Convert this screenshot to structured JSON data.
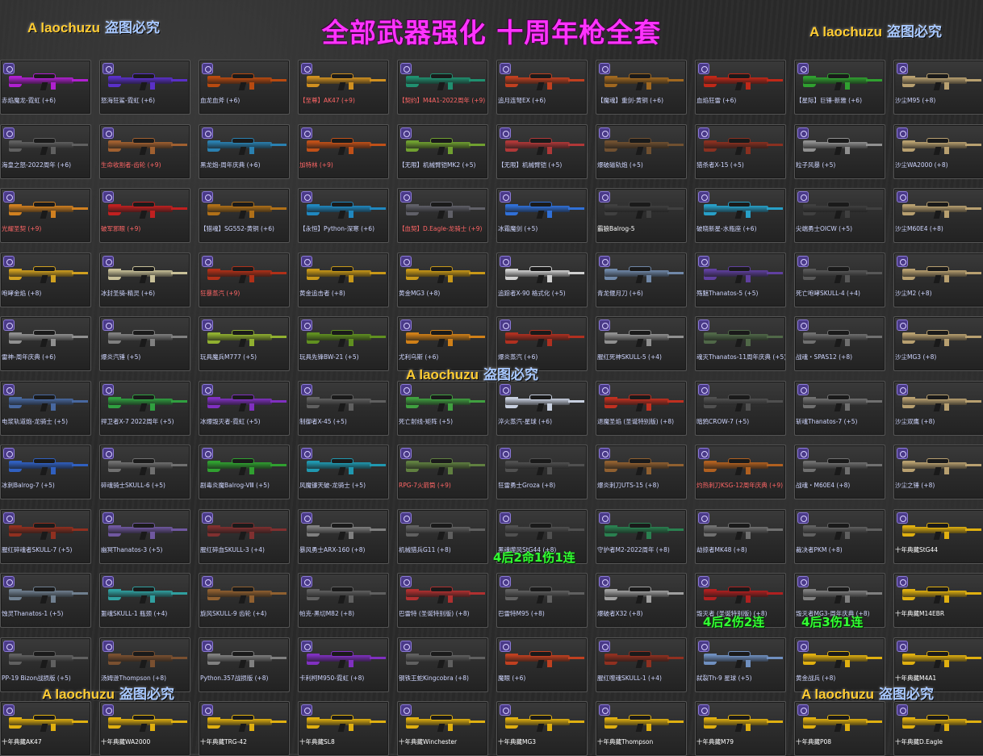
{
  "title": "全部武器强化  十周年枪全套",
  "watermark": {
    "en": "A laochuzu",
    "cn": "盗图必究"
  },
  "overlays": [
    "4后2命1伤1连",
    "4后2伤2连",
    "4后3伤1连"
  ],
  "items": [
    {
      "name": "赤焰魔龙-霓虹 (+6)",
      "color": "#b020d0",
      "label_color": "normal"
    },
    {
      "name": "怒海狂鲨-霓虹 (+6)",
      "color": "#5a30c8",
      "label_color": "normal"
    },
    {
      "name": "血龙血斧 (+6)",
      "color": "#b84a10",
      "label_color": "normal"
    },
    {
      "name": "【至尊】AK47 (+9)",
      "color": "#d09020",
      "label_color": "red"
    },
    {
      "name": "【契约】M4A1-2022周年 (+9)",
      "color": "#209070",
      "label_color": "red"
    },
    {
      "name": "追月连弩EX (+6)",
      "color": "#c04020",
      "label_color": "normal"
    },
    {
      "name": "【魔魂】重剑-黄铜 (+6)",
      "color": "#a06820",
      "label_color": "normal"
    },
    {
      "name": "血焰狂雷 (+6)",
      "color": "#c02818",
      "label_color": "normal"
    },
    {
      "name": "【星际】巨锤-新雅 (+6)",
      "color": "#30a030",
      "label_color": "normal"
    },
    {
      "name": "沙尘M95 (+8)",
      "color": "#b8a070",
      "label_color": "normal"
    },
    {
      "name": "海皇之怒-2022周年 (+6)",
      "color": "#606060",
      "label_color": "normal"
    },
    {
      "name": "生命收割者-齿轮 (+9)",
      "color": "#a06030",
      "label_color": "red"
    },
    {
      "name": "黑龙炮-周年庆典 (+6)",
      "color": "#2a80b0",
      "label_color": "normal"
    },
    {
      "name": "加特林 (+9)",
      "color": "#c05018",
      "label_color": "red"
    },
    {
      "name": "【无限】机械臂铠MK2 (+5)",
      "color": "#70a030",
      "label_color": "normal"
    },
    {
      "name": "【无限】机械臂铠 (+5)",
      "color": "#b03838",
      "label_color": "normal"
    },
    {
      "name": "爆破磁轨炮 (+5)",
      "color": "#705030",
      "label_color": "normal"
    },
    {
      "name": "猎杀者X-15 (+5)",
      "color": "#8a3020",
      "label_color": "normal"
    },
    {
      "name": "粒子风暴 (+5)",
      "color": "#909090",
      "label_color": "normal"
    },
    {
      "name": "沙尘WA2000 (+8)",
      "color": "#b8a070",
      "label_color": "normal"
    },
    {
      "name": "光耀圣契 (+9)",
      "color": "#d08020",
      "label_color": "red"
    },
    {
      "name": "破军邪眼 (+9)",
      "color": "#c02020",
      "label_color": "red"
    },
    {
      "name": "【猎魂】SG552-黄铜 (+6)",
      "color": "#b07018",
      "label_color": "normal"
    },
    {
      "name": "【永恒】Python-深寒 (+6)",
      "color": "#2088c0",
      "label_color": "normal"
    },
    {
      "name": "【血契】D.Eagle-龙骑士 (+9)",
      "color": "#606068",
      "label_color": "red"
    },
    {
      "name": "冰霜魔剑 (+5)",
      "color": "#3070d8",
      "label_color": "normal"
    },
    {
      "name": "霸狼Balrog-5",
      "color": "#404040",
      "label_color": "white"
    },
    {
      "name": "破晓新星-水瓶座 (+6)",
      "color": "#28a0c8",
      "label_color": "normal"
    },
    {
      "name": "尖端勇士OICW (+5)",
      "color": "#404040",
      "label_color": "normal"
    },
    {
      "name": "沙尘M60E4 (+8)",
      "color": "#b8a070",
      "label_color": "normal"
    },
    {
      "name": "咆哮金焰 (+8)",
      "color": "#d0a020",
      "label_color": "normal"
    },
    {
      "name": "冰封圣骑-精灵 (+6)",
      "color": "#c8c098",
      "label_color": "normal"
    },
    {
      "name": "狂暴蒸汽 (+9)",
      "color": "#b03018",
      "label_color": "red"
    },
    {
      "name": "黄金追击者 (+8)",
      "color": "#c89818",
      "label_color": "normal"
    },
    {
      "name": "黄金MG3 (+8)",
      "color": "#c89818",
      "label_color": "normal"
    },
    {
      "name": "追踪者X-90 格式化 (+5)",
      "color": "#d0d0d0",
      "label_color": "normal"
    },
    {
      "name": "青龙偃月刀 (+6)",
      "color": "#7088a8",
      "label_color": "normal"
    },
    {
      "name": "殇魅Thanatos-5 (+5)",
      "color": "#6040a0",
      "label_color": "normal"
    },
    {
      "name": "死亡咆哮SKULL-4 (+4)",
      "color": "#585858",
      "label_color": "normal"
    },
    {
      "name": "沙尘M2 (+8)",
      "color": "#b8a070",
      "label_color": "normal"
    },
    {
      "name": "雷神-周年庆典 (+6)",
      "color": "#909090",
      "label_color": "normal"
    },
    {
      "name": "爆炎汽锤 (+5)",
      "color": "#808080",
      "label_color": "normal"
    },
    {
      "name": "玩具魔兵M777 (+5)",
      "color": "#90b030",
      "label_color": "normal"
    },
    {
      "name": "玩具先锋BW-21 (+5)",
      "color": "#609020",
      "label_color": "normal"
    },
    {
      "name": "尤利乌斯 (+6)",
      "color": "#d08018",
      "label_color": "normal"
    },
    {
      "name": "爆炎蒸汽 (+6)",
      "color": "#b03020",
      "label_color": "normal"
    },
    {
      "name": "腥红死神SKULL-5 (+4)",
      "color": "#909090",
      "label_color": "normal"
    },
    {
      "name": "魂灭Thanatos-11周年庆典 (+5)",
      "color": "#506848",
      "label_color": "normal"
    },
    {
      "name": "战魂・SPAS12 (+8)",
      "color": "#707070",
      "label_color": "normal"
    },
    {
      "name": "沙尘MG3 (+8)",
      "color": "#b8a070",
      "label_color": "normal"
    },
    {
      "name": "电浆轨道炮-龙骑士 (+5)",
      "color": "#4868a0",
      "label_color": "normal"
    },
    {
      "name": "捍卫者X-7 2022周年 (+5)",
      "color": "#30a040",
      "label_color": "normal"
    },
    {
      "name": "冰爆毁灭者-霓虹 (+5)",
      "color": "#8030c0",
      "label_color": "normal"
    },
    {
      "name": "制御者X-45 (+5)",
      "color": "#606060",
      "label_color": "normal"
    },
    {
      "name": "死亡射线-矩阵 (+5)",
      "color": "#40a040",
      "label_color": "normal"
    },
    {
      "name": "淬火蒸汽-星球 (+6)",
      "color": "#c8d0e0",
      "label_color": "normal"
    },
    {
      "name": "退魔圣焰 (圣诞特别版) (+8)",
      "color": "#c03020",
      "label_color": "normal"
    },
    {
      "name": "暗鸦CROW-7 (+5)",
      "color": "#505050",
      "label_color": "normal"
    },
    {
      "name": "斩魂Thanatos-7 (+5)",
      "color": "#707070",
      "label_color": "normal"
    },
    {
      "name": "沙尘双鹰 (+8)",
      "color": "#b8a070",
      "label_color": "normal"
    },
    {
      "name": "冰刺Balrog-7 (+5)",
      "color": "#3060c0",
      "label_color": "normal"
    },
    {
      "name": "碎魂骑士SKULL-6 (+5)",
      "color": "#707070",
      "label_color": "normal"
    },
    {
      "name": "剧毒炎魔Balrog-VⅢ (+5)",
      "color": "#30a030",
      "label_color": "normal"
    },
    {
      "name": "风魔镰天破-龙骑士 (+5)",
      "color": "#2098b0",
      "label_color": "normal"
    },
    {
      "name": "RPG-7火箭筒 (+9)",
      "color": "#608040",
      "label_color": "red"
    },
    {
      "name": "狂雷勇士Groza (+8)",
      "color": "#505050",
      "label_color": "normal"
    },
    {
      "name": "爆炎刺刀UTS-15 (+8)",
      "color": "#906030",
      "label_color": "normal"
    },
    {
      "name": "灼热刺刀KSG-12周年庆典 (+9)",
      "color": "#b06020",
      "label_color": "red"
    },
    {
      "name": "战魂・M60E4 (+8)",
      "color": "#707070",
      "label_color": "normal"
    },
    {
      "name": "沙尘之锤 (+8)",
      "color": "#b8a070",
      "label_color": "normal"
    },
    {
      "name": "腥红碎魂者SKULL-7 (+5)",
      "color": "#903020",
      "label_color": "normal"
    },
    {
      "name": "幽冥Thanatos-3 (+5)",
      "color": "#7058a0",
      "label_color": "normal"
    },
    {
      "name": "腥红碎血SKULL-3 (+4)",
      "color": "#803030",
      "label_color": "normal"
    },
    {
      "name": "暴风勇士ARX-160 (+8)",
      "color": "#808080",
      "label_color": "normal"
    },
    {
      "name": "机械猎兵G11 (+8)",
      "color": "#606060",
      "label_color": "normal"
    },
    {
      "name": "黑魂噬风StG44 (+8)",
      "color": "#505050",
      "label_color": "normal"
    },
    {
      "name": "守护者M2-2022周年 (+8)",
      "color": "#2a8050",
      "label_color": "normal"
    },
    {
      "name": "劫掠者MK48 (+8)",
      "color": "#707070",
      "label_color": "normal"
    },
    {
      "name": "裁决者PKM (+8)",
      "color": "#606060",
      "label_color": "normal"
    },
    {
      "name": "十年典藏StG44",
      "color": "#e0b010",
      "label_color": "white"
    },
    {
      "name": "蚀灵Thanatos-1 (+5)",
      "color": "#708090",
      "label_color": "normal"
    },
    {
      "name": "噩魂SKULL-1 瓶颈 (+4)",
      "color": "#30a0a0",
      "label_color": "normal"
    },
    {
      "name": "旋风SKULL-9 齿轮 (+4)",
      "color": "#906030",
      "label_color": "normal"
    },
    {
      "name": "帕克-黑切M82 (+8)",
      "color": "#606060",
      "label_color": "normal"
    },
    {
      "name": "巴雷特 (圣诞特别版) (+8)",
      "color": "#b03030",
      "label_color": "normal"
    },
    {
      "name": "巴雷特M95 (+8)",
      "color": "#606060",
      "label_color": "normal"
    },
    {
      "name": "爆破者X32 (+8)",
      "color": "#a0a0a0",
      "label_color": "normal"
    },
    {
      "name": "毁灭者 (圣诞特别版) (+8)",
      "color": "#b02020",
      "label_color": "normal"
    },
    {
      "name": "毁灭者MG3-周年庆典 (+8)",
      "color": "#808080",
      "label_color": "normal"
    },
    {
      "name": "十年典藏M14EBR",
      "color": "#e0b010",
      "label_color": "white"
    },
    {
      "name": "PP-19 Bizon战损版 (+5)",
      "color": "#606060",
      "label_color": "normal"
    },
    {
      "name": "汤姆逊Thompson (+8)",
      "color": "#7a5030",
      "label_color": "normal"
    },
    {
      "name": "Python.357战损版 (+8)",
      "color": "#808080",
      "label_color": "normal"
    },
    {
      "name": "卡利柯M950-霓虹 (+8)",
      "color": "#8030c0",
      "label_color": "normal"
    },
    {
      "name": "钢铁王蛇Kingcobra (+8)",
      "color": "#606060",
      "label_color": "normal"
    },
    {
      "name": "魔眼 (+6)",
      "color": "#c04020",
      "label_color": "normal"
    },
    {
      "name": "腥红噬魂SKULL-1 (+4)",
      "color": "#903020",
      "label_color": "normal"
    },
    {
      "name": "弑裂Th-9 星球 (+5)",
      "color": "#7090c0",
      "label_color": "normal"
    },
    {
      "name": "黄金战兵 (+8)",
      "color": "#e0b010",
      "label_color": "normal"
    },
    {
      "name": "十年典藏M4A1",
      "color": "#e0b010",
      "label_color": "white"
    },
    {
      "name": "十年典藏AK47",
      "color": "#e0b010",
      "label_color": "white"
    },
    {
      "name": "十年典藏WA2000",
      "color": "#e0b010",
      "label_color": "white"
    },
    {
      "name": "十年典藏TRG-42",
      "color": "#e0b010",
      "label_color": "white"
    },
    {
      "name": "十年典藏SL8",
      "color": "#e0b010",
      "label_color": "white"
    },
    {
      "name": "十年典藏Winchester",
      "color": "#e0b010",
      "label_color": "white"
    },
    {
      "name": "十年典藏MG3",
      "color": "#e0b010",
      "label_color": "white"
    },
    {
      "name": "十年典藏Thompson",
      "color": "#e0b010",
      "label_color": "white"
    },
    {
      "name": "十年典藏M79",
      "color": "#e0b010",
      "label_color": "white"
    },
    {
      "name": "十年典藏P08",
      "color": "#e0b010",
      "label_color": "white"
    },
    {
      "name": "十年典藏D.Eagle",
      "color": "#e0b010",
      "label_color": "white"
    }
  ]
}
